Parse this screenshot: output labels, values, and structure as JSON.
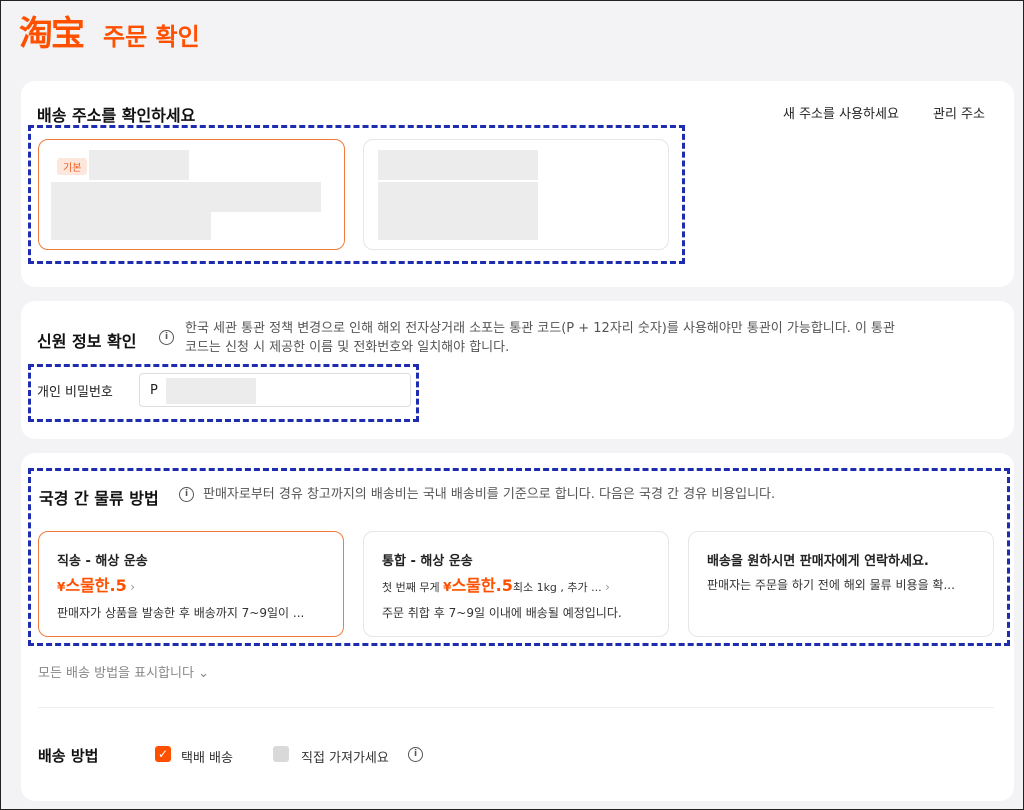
{
  "header": {
    "logo": "淘宝",
    "title": "주문 확인"
  },
  "address": {
    "title": "배송 주소를 확인하세요",
    "new_address_link": "새 주소를 사용하세요",
    "manage_link": "관리 주소",
    "default_badge": "기본"
  },
  "identity": {
    "title": "신원 정보 확인",
    "note_line1": "한국 세관 통관 정책 변경으로 인해 해외 전자상거래 소포는 통관 코드(P + 12자리 숫자)를 사용해야만 통관이 가능합니다. 이 통관",
    "note_line2": "코드는 신청 시 제공한 이름 및 전화번호와 일치해야 합니다.",
    "field_label": "개인 비밀번호",
    "field_value": "P"
  },
  "shipping": {
    "title": "국경 간 물류 방법",
    "note": "판매자로부터 경유 창고까지의 배송비는 국내 배송비를 기준으로 합니다. 다음은 국경 간 경유 비용입니다.",
    "options": [
      {
        "title": "직송 - 해상 운송",
        "currency": "¥",
        "price": "스물한.5",
        "desc": "판매자가 상품을 발송한 후 배송까지 7~9일이 ..."
      },
      {
        "title": "통합 - 해상 운송",
        "prefix": "첫 번째 무게",
        "currency": "¥",
        "price": "스물한.5",
        "suffix": "최소  1kg , 추가 ...",
        "desc": "주문 취합 후 7~9일 이내에 배송될 예정입니다."
      },
      {
        "title": "배송을 원하시면 판매자에게 연락하세요.",
        "desc": "판매자는 주문을 하기 전에 해외 물류 비용을 확..."
      }
    ],
    "show_all": "모든 배송 방법을 표시합니다",
    "method_label": "배송 방법",
    "method_courier": "택배 배송",
    "method_pickup": "직접 가져가세요"
  },
  "colors": {
    "accent": "#ff5000",
    "highlight_border": "#1e2cb0"
  }
}
